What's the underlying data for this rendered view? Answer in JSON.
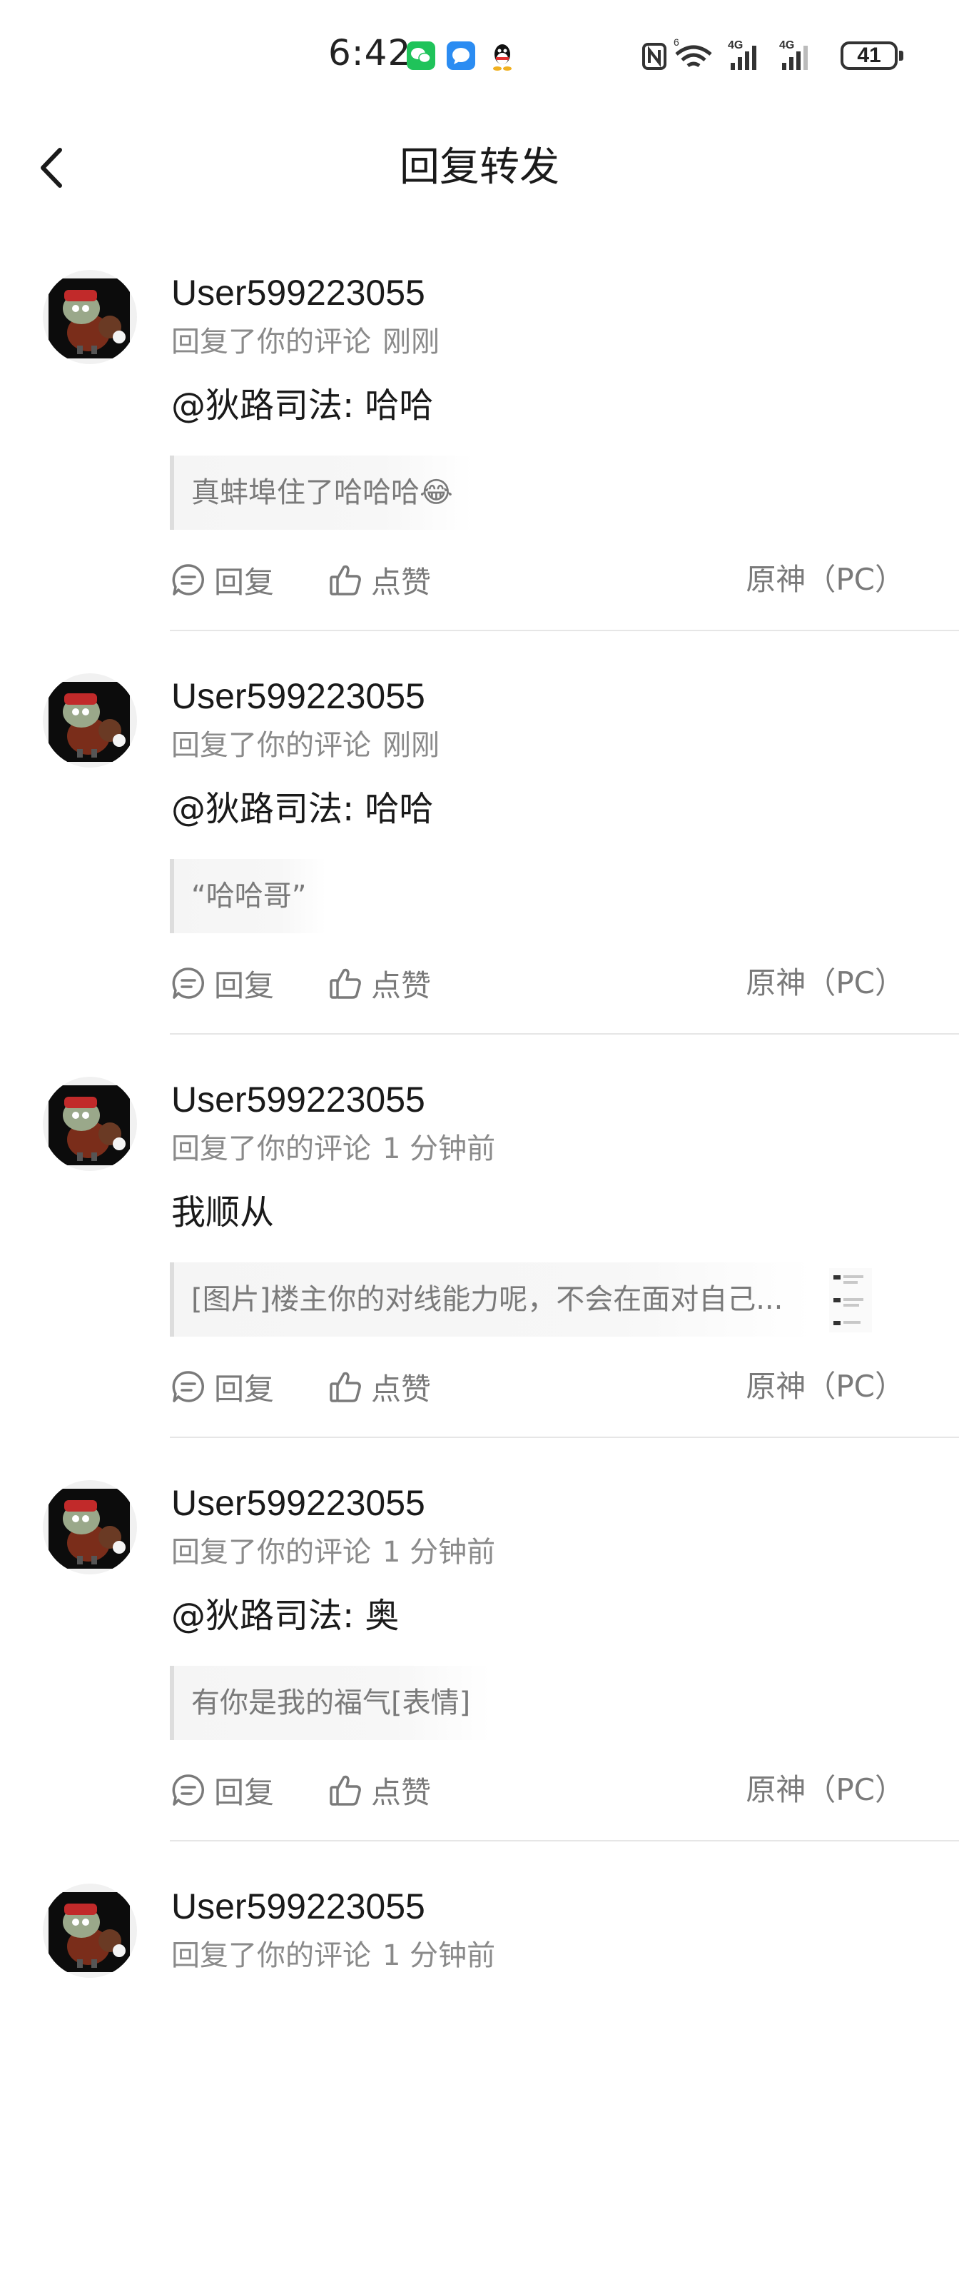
{
  "status_bar": {
    "time": "6:42",
    "battery": "41",
    "notifications": [
      "wechat-icon",
      "message-icon",
      "qq-icon"
    ],
    "system_icons": [
      "nfc-icon",
      "wifi-icon",
      "signal-4g-icon",
      "signal-4g-icon",
      "battery-icon"
    ]
  },
  "header": {
    "title": "回复转发",
    "back_icon": "back-arrow-icon"
  },
  "items": [
    {
      "username": "User599223055",
      "action": "回复了你的评论",
      "time": "刚刚",
      "content": "@狄路司法: 哈哈",
      "quote": "真蚌埠住了哈哈哈😂",
      "reply_label": "回复",
      "like_label": "点赞",
      "source": "原神（PC）"
    },
    {
      "username": "User599223055",
      "action": "回复了你的评论",
      "time": "刚刚",
      "content": "@狄路司法: 哈哈",
      "quote": "“哈哈哥”",
      "reply_label": "回复",
      "like_label": "点赞",
      "source": "原神（PC）"
    },
    {
      "username": "User599223055",
      "action": "回复了你的评论",
      "time": "1 分钟前",
      "content": "我顺从",
      "quote": "[图片]楼主你的对线能力呢，不会在面对自己...",
      "reply_label": "回复",
      "like_label": "点赞",
      "source": "原神（PC）"
    },
    {
      "username": "User599223055",
      "action": "回复了你的评论",
      "time": "1 分钟前",
      "content": "@狄路司法: 奥",
      "quote": "有你是我的福气[表情]",
      "reply_label": "回复",
      "like_label": "点赞",
      "source": "原神（PC）"
    },
    {
      "username": "User599223055",
      "action": "回复了你的评论",
      "time": "1 分钟前"
    }
  ],
  "colors": {
    "text_primary": "#1a1a1a",
    "text_secondary": "#8a8a8a",
    "quote_bar": "#dddddd",
    "divider": "#e6e6e6"
  }
}
